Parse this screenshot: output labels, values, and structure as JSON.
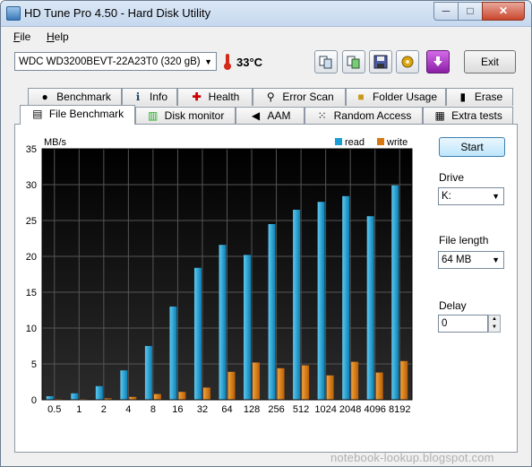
{
  "window": {
    "title": "HD Tune Pro 4.50 - Hard Disk Utility",
    "minimize": "─",
    "maximize": "□",
    "close": "✕"
  },
  "menu": [
    {
      "key": "F",
      "rest": "ile"
    },
    {
      "key": "H",
      "rest": "elp"
    }
  ],
  "toolbar": {
    "drive": "WDC WD3200BEVT-22A23T0   (320 gB)",
    "temperature": "33°C",
    "icons": [
      "copy-info-icon",
      "copy-screenshot-icon",
      "save-icon",
      "options-icon",
      "update-icon"
    ],
    "exit_label": "Exit"
  },
  "tabs_top": [
    {
      "label": "Benchmark",
      "icon": "benchmark-icon"
    },
    {
      "label": "Info",
      "icon": "info-icon"
    },
    {
      "label": "Health",
      "icon": "health-icon"
    },
    {
      "label": "Error Scan",
      "icon": "error-scan-icon"
    },
    {
      "label": "Folder Usage",
      "icon": "folder-icon"
    },
    {
      "label": "Erase",
      "icon": "erase-icon"
    }
  ],
  "tabs_bottom": [
    {
      "label": "File Benchmark",
      "icon": "file-benchmark-icon",
      "active": true
    },
    {
      "label": "Disk monitor",
      "icon": "disk-monitor-icon"
    },
    {
      "label": "AAM",
      "icon": "speaker-icon"
    },
    {
      "label": "Random Access",
      "icon": "random-access-icon"
    },
    {
      "label": "Extra tests",
      "icon": "extra-tests-icon"
    }
  ],
  "sidebar": {
    "start_label": "Start",
    "drive_label": "Drive",
    "drive_value": "K:",
    "file_length_label": "File length",
    "file_length_value": "64 MB",
    "delay_label": "Delay",
    "delay_value": "0"
  },
  "chart_data": {
    "type": "bar",
    "ylabel": "MB/s",
    "ylim": [
      0,
      35
    ],
    "yticks": [
      0,
      5,
      10,
      15,
      20,
      25,
      30,
      35
    ],
    "categories": [
      "0.5",
      "1",
      "2",
      "4",
      "8",
      "16",
      "32",
      "64",
      "128",
      "256",
      "512",
      "1024",
      "2048",
      "4096",
      "8192"
    ],
    "series": [
      {
        "name": "read",
        "color": "#1a9ed6",
        "values": [
          0.5,
          0.9,
          1.9,
          4.1,
          7.5,
          13.0,
          18.4,
          21.6,
          20.2,
          24.5,
          26.5,
          27.6,
          28.4,
          25.6,
          29.9
        ]
      },
      {
        "name": "write",
        "color": "#d9780f",
        "values": [
          0.1,
          0.1,
          0.2,
          0.4,
          0.8,
          1.1,
          1.7,
          3.9,
          5.2,
          4.4,
          4.8,
          3.4,
          5.3,
          3.8,
          5.4
        ]
      }
    ],
    "legend": "top-right",
    "grid": true
  },
  "watermark": "notebook-lookup.blogspot.com"
}
